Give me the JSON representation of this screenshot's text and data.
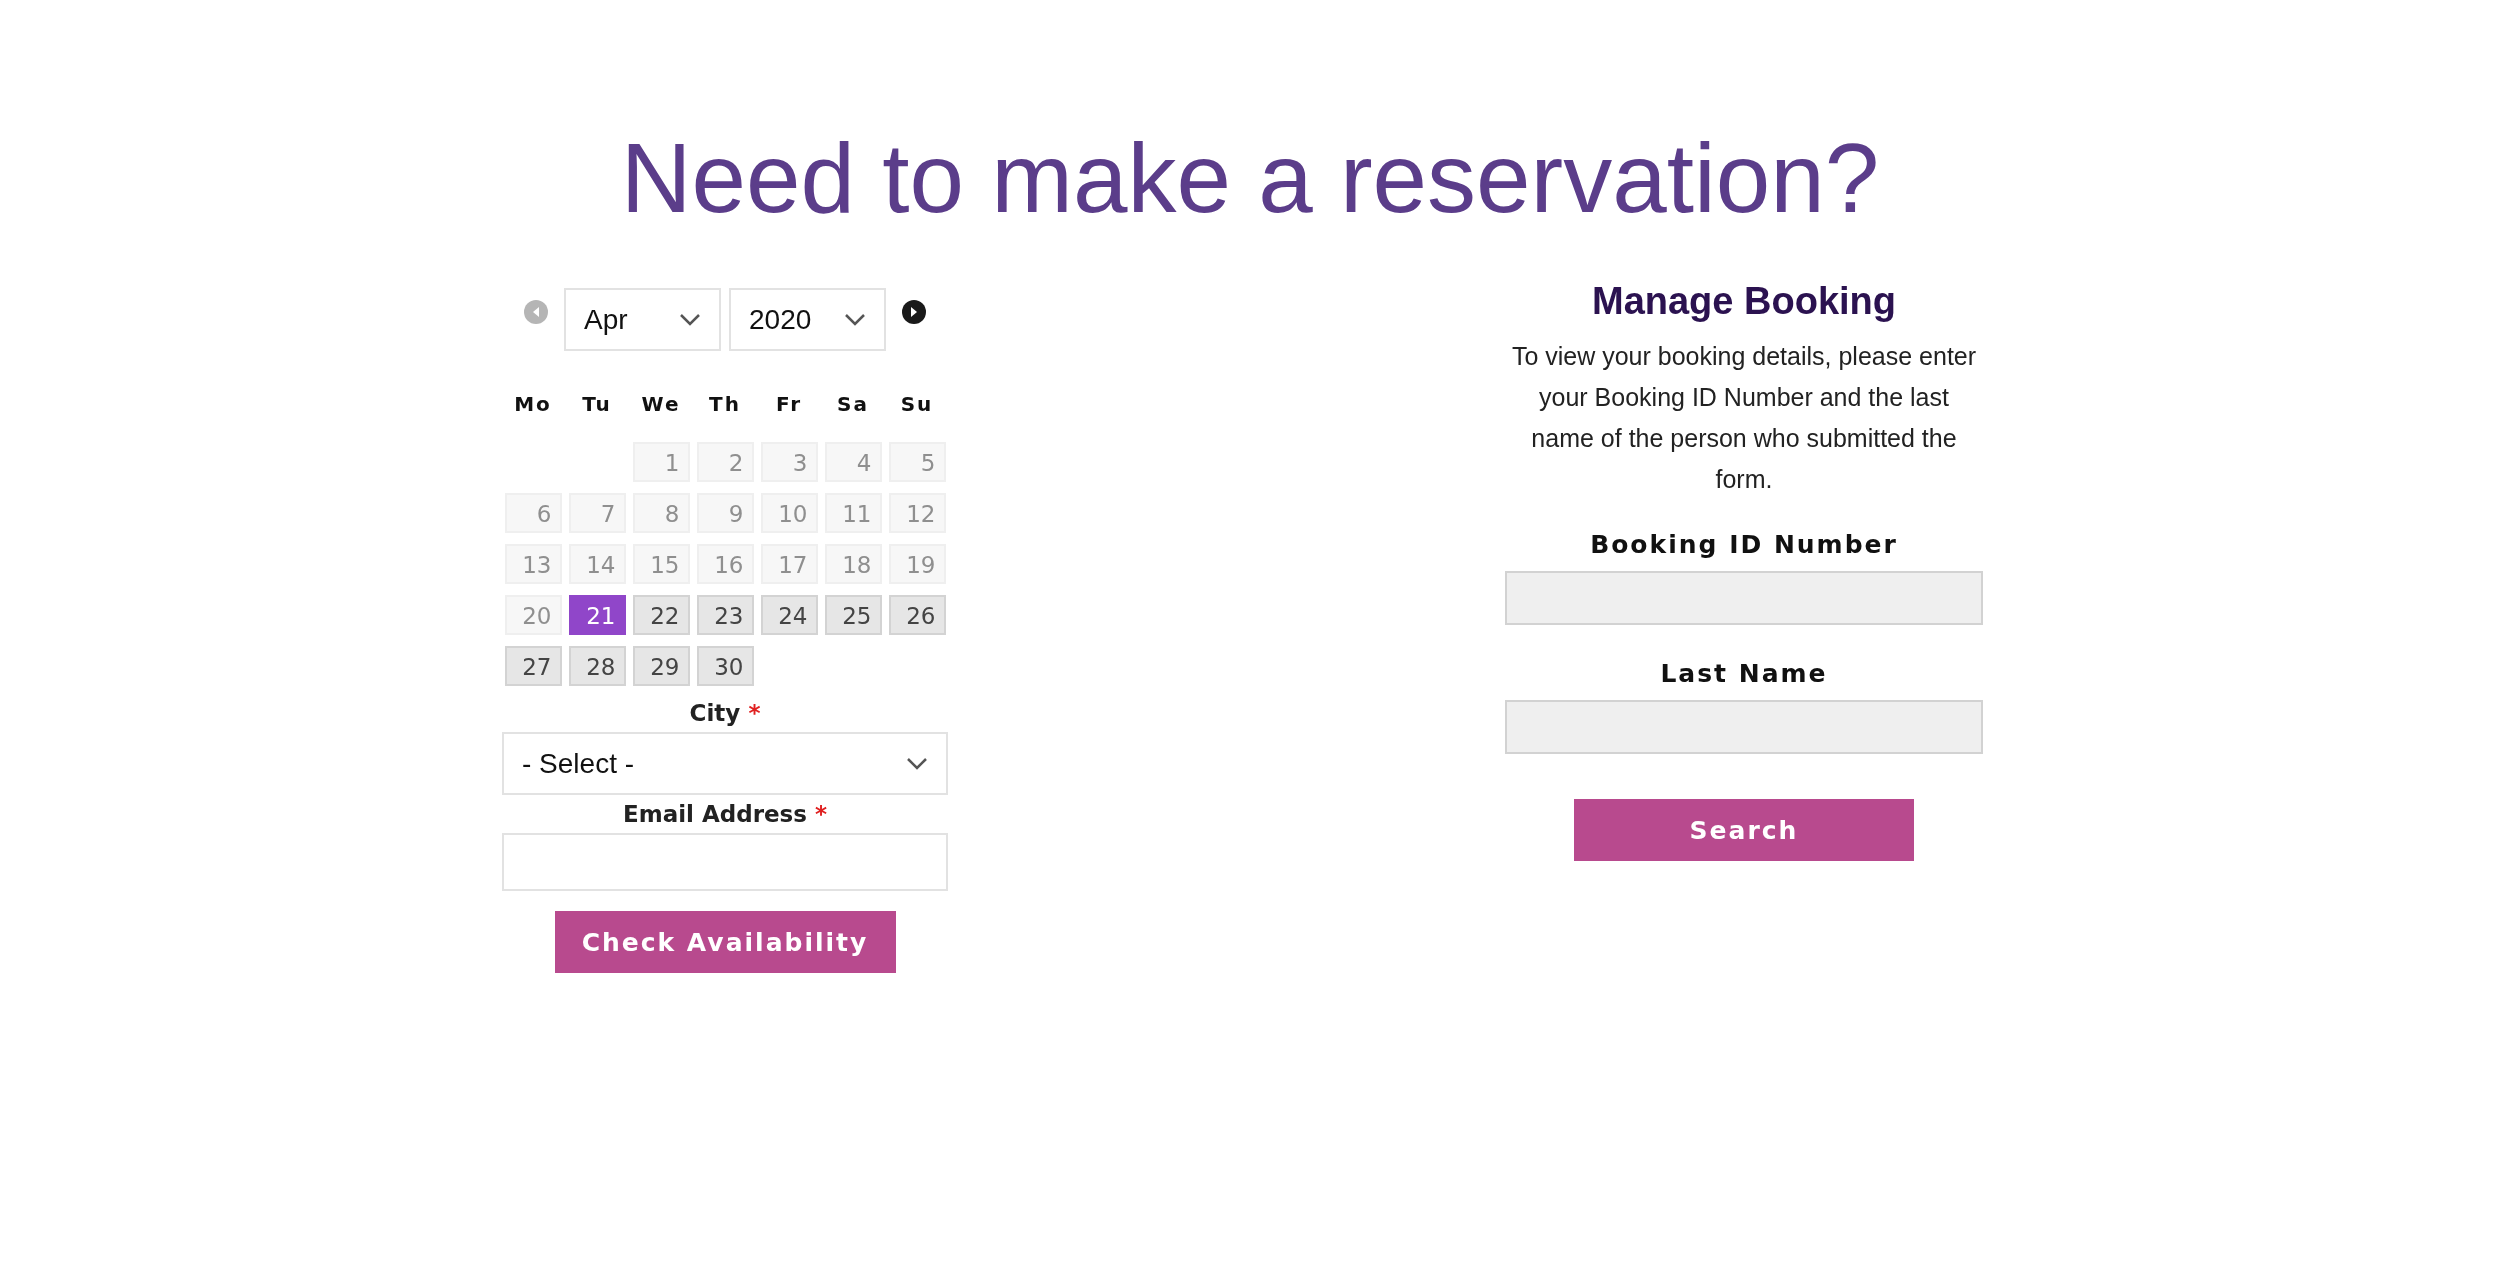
{
  "title": "Need to make a reservation?",
  "calendar": {
    "prev": {
      "disabled": true
    },
    "next": {
      "disabled": false
    },
    "month": "Apr",
    "year": "2020",
    "weekdays": [
      "Mo",
      "Tu",
      "We",
      "Th",
      "Fr",
      "Sa",
      "Su"
    ],
    "weeks": [
      [
        {
          "day": "1",
          "disabled": true,
          "selected": false
        },
        {
          "day": "2",
          "disabled": true,
          "selected": false
        },
        {
          "day": "3",
          "disabled": true,
          "selected": false
        },
        {
          "day": "4",
          "disabled": true,
          "selected": false
        },
        {
          "day": "5",
          "disabled": true,
          "selected": false
        }
      ],
      [
        {
          "day": "6",
          "disabled": true,
          "selected": false
        },
        {
          "day": "7",
          "disabled": true,
          "selected": false
        },
        {
          "day": "8",
          "disabled": true,
          "selected": false
        },
        {
          "day": "9",
          "disabled": true,
          "selected": false
        },
        {
          "day": "10",
          "disabled": true,
          "selected": false
        },
        {
          "day": "11",
          "disabled": true,
          "selected": false
        },
        {
          "day": "12",
          "disabled": true,
          "selected": false
        }
      ],
      [
        {
          "day": "13",
          "disabled": true,
          "selected": false
        },
        {
          "day": "14",
          "disabled": true,
          "selected": false
        },
        {
          "day": "15",
          "disabled": true,
          "selected": false
        },
        {
          "day": "16",
          "disabled": true,
          "selected": false
        },
        {
          "day": "17",
          "disabled": true,
          "selected": false
        },
        {
          "day": "18",
          "disabled": true,
          "selected": false
        },
        {
          "day": "19",
          "disabled": true,
          "selected": false
        }
      ],
      [
        {
          "day": "20",
          "disabled": true,
          "selected": false
        },
        {
          "day": "21",
          "disabled": false,
          "selected": true
        },
        {
          "day": "22",
          "disabled": false,
          "selected": false
        },
        {
          "day": "23",
          "disabled": false,
          "selected": false
        },
        {
          "day": "24",
          "disabled": false,
          "selected": false
        },
        {
          "day": "25",
          "disabled": false,
          "selected": false
        },
        {
          "day": "26",
          "disabled": false,
          "selected": false
        }
      ],
      [
        {
          "day": "27",
          "disabled": false,
          "selected": false
        },
        {
          "day": "28",
          "disabled": false,
          "selected": false
        },
        {
          "day": "29",
          "disabled": false,
          "selected": false
        },
        {
          "day": "30",
          "disabled": false,
          "selected": false
        }
      ]
    ]
  },
  "city": {
    "label": "City",
    "required_mark": "*",
    "value": "- Select -"
  },
  "email": {
    "label": "Email Address",
    "required_mark": "*"
  },
  "check_button": "Check Availability",
  "manage": {
    "heading": "Manage Booking",
    "text": "To view your booking details, please enter your Booking ID Number and the last name of the person who submitted the form.",
    "fields": [
      {
        "label": "Booking ID Number"
      },
      {
        "label": "Last Name"
      }
    ],
    "button": "Search"
  }
}
